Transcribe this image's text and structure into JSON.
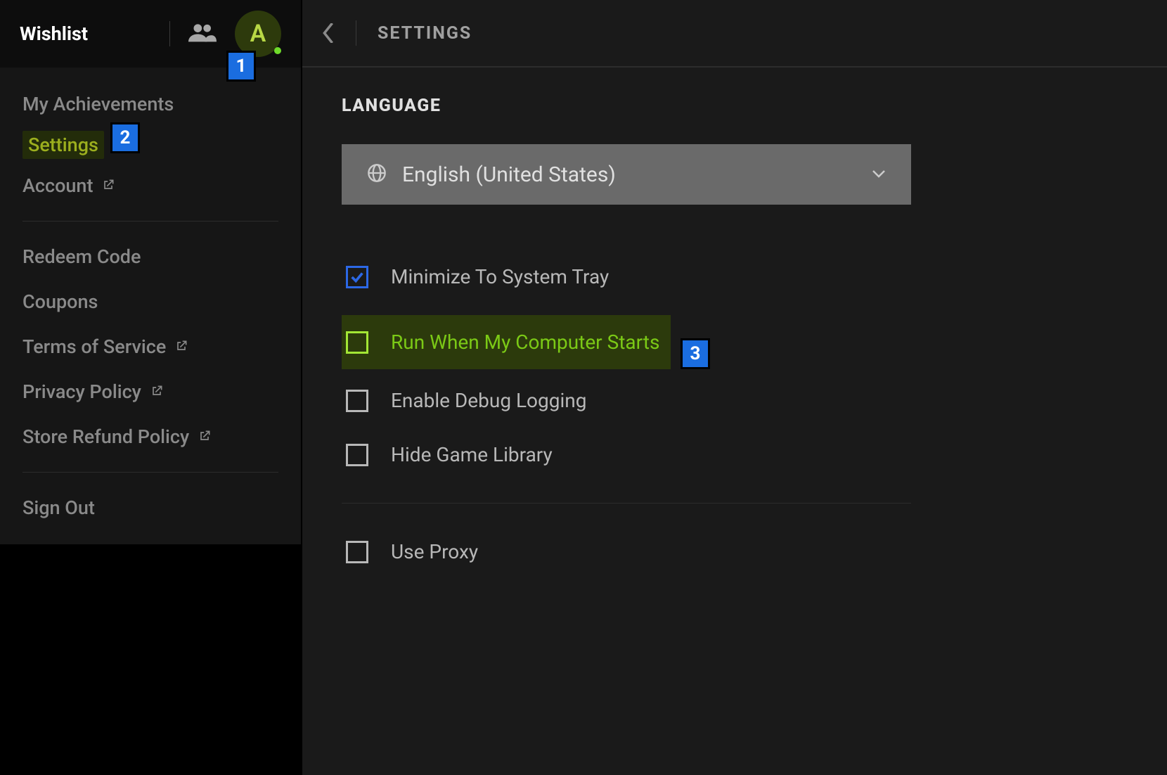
{
  "sidebar": {
    "wishlist_label": "Wishlist",
    "avatar_letter": "A",
    "items": [
      {
        "label": "My Achievements"
      },
      {
        "label": "Settings"
      },
      {
        "label": "Account"
      },
      {
        "label": "Redeem Code"
      },
      {
        "label": "Coupons"
      },
      {
        "label": "Terms of Service"
      },
      {
        "label": "Privacy Policy"
      },
      {
        "label": "Store Refund Policy"
      },
      {
        "label": "Sign Out"
      }
    ]
  },
  "main": {
    "title": "SETTINGS",
    "language_section": "LANGUAGE",
    "language_value": "English (United States)",
    "options": [
      {
        "label": "Minimize To System Tray"
      },
      {
        "label": "Run When My Computer Starts"
      },
      {
        "label": "Enable Debug Logging"
      },
      {
        "label": "Hide Game Library"
      },
      {
        "label": "Use Proxy"
      }
    ]
  },
  "annotations": {
    "a1": "1",
    "a2": "2",
    "a3": "3"
  }
}
